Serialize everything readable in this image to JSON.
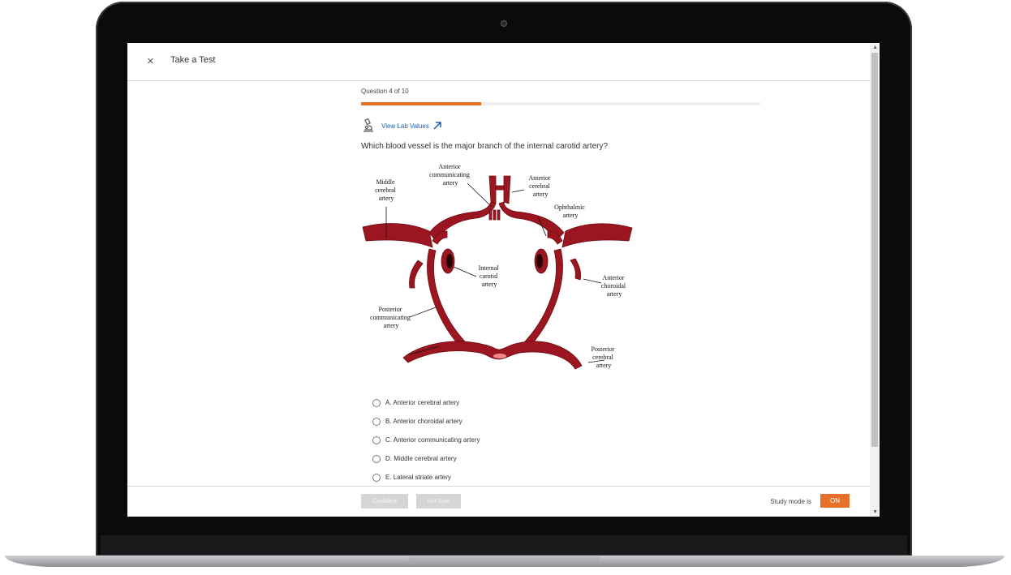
{
  "topbar": {
    "close_icon": "×",
    "title": "Take a Test"
  },
  "question": {
    "counter": "Question 4 of 10",
    "progress_fraction": 0.3,
    "lab_link": "View Lab Values",
    "text": "Which blood vessel is the major branch of the internal carotid artery?"
  },
  "diagram": {
    "labels": {
      "anterior_communicating": [
        "Anterior",
        "communicating",
        "artery"
      ],
      "middle_cerebral": [
        "Middle",
        "cerebral",
        "artery"
      ],
      "anterior_cerebral": [
        "Anterior",
        "cerebral",
        "artery"
      ],
      "ophthalmic": [
        "Ophthalmic",
        "artery"
      ],
      "internal_carotid": [
        "Internal",
        "carotid",
        "artery"
      ],
      "anterior_choroidal": [
        "Anterior",
        "choroidal",
        "artery"
      ],
      "posterior_communicating": [
        "Posterior",
        "communicating",
        "artery"
      ],
      "posterior_cerebral": [
        "Posterior",
        "cerebral",
        "artery"
      ]
    }
  },
  "options": [
    {
      "label": "A. Anterior cerebral artery"
    },
    {
      "label": "B. Anterior choroidal artery"
    },
    {
      "label": "C. Anterior communicating artery"
    },
    {
      "label": "D. Middle cerebral artery"
    },
    {
      "label": "E. Lateral striate artery"
    }
  ],
  "footer": {
    "confident": "Confident",
    "not_sure": "Not Sure",
    "study_mode_label": "Study mode is",
    "study_mode_value": "ON"
  },
  "colors": {
    "accent": "#e8702a",
    "artery": "#9b1620",
    "link": "#1a5ea8"
  }
}
